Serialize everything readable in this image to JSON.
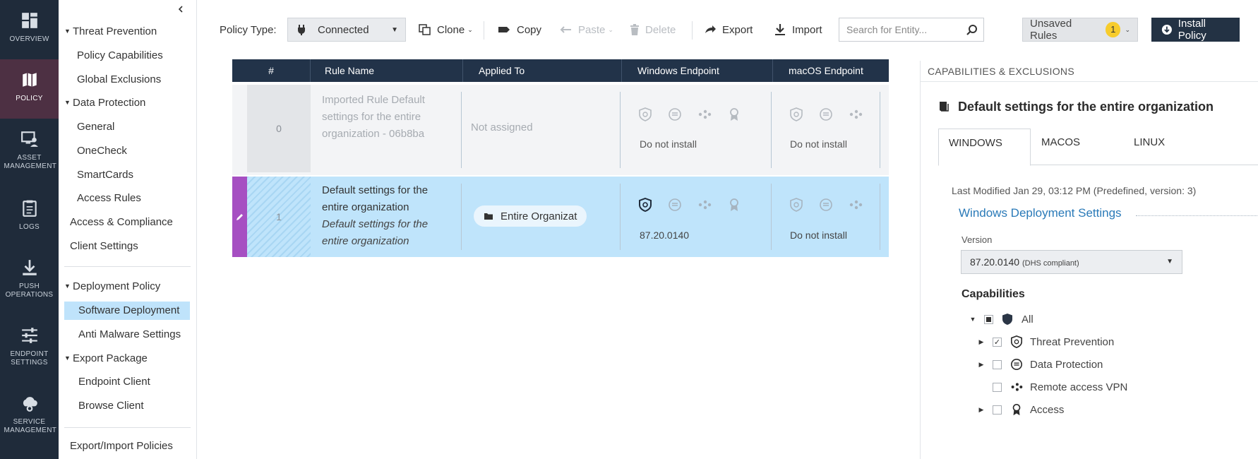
{
  "nav": {
    "items": [
      {
        "label": "OVERVIEW",
        "icon": "grid-icon"
      },
      {
        "label": "POLICY",
        "icon": "map-icon"
      },
      {
        "label": "ASSET MANAGEMENT",
        "icon": "monitor-user-icon"
      },
      {
        "label": "LOGS",
        "icon": "clipboard-icon"
      },
      {
        "label": "PUSH OPERATIONS",
        "icon": "download-icon"
      },
      {
        "label": "ENDPOINT SETTINGS",
        "icon": "sliders-icon"
      },
      {
        "label": "SERVICE MANAGEMENT",
        "icon": "cloud-gear-icon"
      }
    ]
  },
  "tree": {
    "threat_prevention": "Threat Prevention",
    "policy_capabilities": "Policy Capabilities",
    "global_exclusions": "Global Exclusions",
    "data_protection": "Data Protection",
    "general": "General",
    "onecheck": "OneCheck",
    "smartcards": "SmartCards",
    "access_rules": "Access Rules",
    "access_compliance": "Access & Compliance",
    "client_settings": "Client Settings",
    "deployment_policy": "Deployment Policy",
    "software_deployment": "Software Deployment",
    "anti_malware": "Anti Malware Settings",
    "export_package": "Export Package",
    "endpoint_client": "Endpoint Client",
    "browse_client": "Browse Client",
    "export_import": "Export/Import Policies"
  },
  "toolbar": {
    "policy_type_label": "Policy Type:",
    "policy_type_value": "Connected",
    "clone": "Clone",
    "copy": "Copy",
    "paste": "Paste",
    "delete": "Delete",
    "export": "Export",
    "import": "Import",
    "search_placeholder": "Search for Entity...",
    "unsaved": "Unsaved Rules",
    "unsaved_count": "1",
    "install": "Install Policy"
  },
  "table": {
    "headers": [
      "#",
      "Rule Name",
      "Applied To",
      "Windows Endpoint",
      "macOS Endpoint"
    ],
    "rows": [
      {
        "num": "0",
        "name": "Imported Rule Default settings for the entire organization - 06b8ba",
        "applied": "Not assigned",
        "windows": "Do not install",
        "macos": "Do not install"
      },
      {
        "num": "1",
        "name": "Default settings for the entire organization",
        "comment": "Default settings for the entire organization",
        "applied": "Entire Organizat",
        "windows": "87.20.0140",
        "macos": "Do not install"
      }
    ]
  },
  "panel": {
    "header": "CAPABILITIES & EXCLUSIONS",
    "title": "Default settings for the entire organization",
    "tabs": [
      "WINDOWS",
      "MACOS",
      "LINUX"
    ],
    "last_modified": "Last Modified Jan 29, 03:12 PM (Predefined, version: 3)",
    "section": "Windows Deployment Settings",
    "version_label": "Version",
    "version_value": "87.20.0140",
    "version_sub": "(DHS compliant)",
    "capabilities_label": "Capabilities",
    "caps": [
      "All",
      "Threat Prevention",
      "Data Protection",
      "Remote access VPN",
      "Access"
    ]
  },
  "colors": {
    "nav_bg": "#1f2b3a",
    "nav_active": "#4d3043",
    "table_header": "#223349",
    "selected_row": "#bfe4fb",
    "edit_marker": "#a64fc2",
    "badge": "#f7cc2c",
    "link_blue": "#2a7ab8"
  }
}
